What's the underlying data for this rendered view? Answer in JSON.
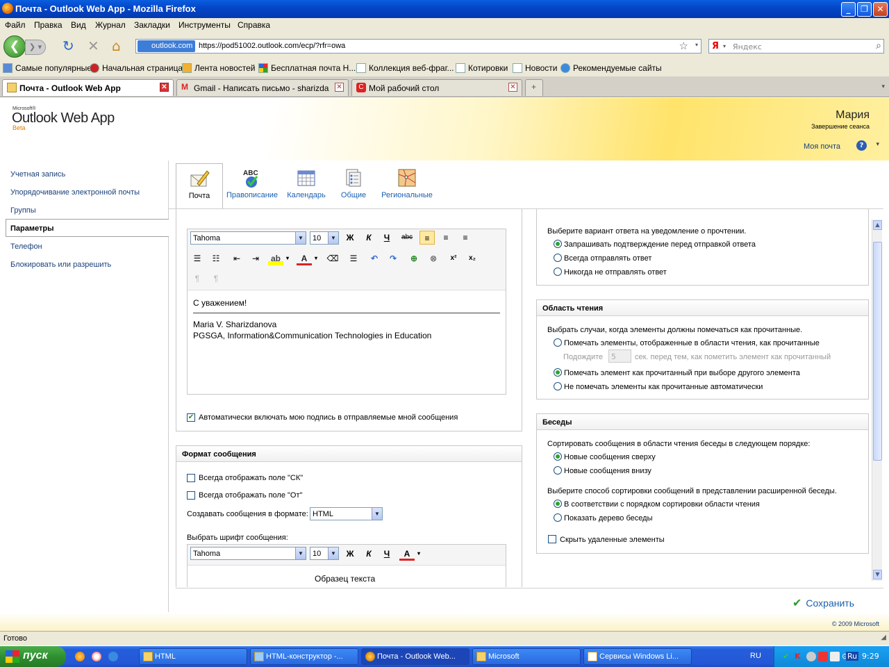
{
  "window": {
    "title": "Почта - Outlook Web App - Mozilla Firefox"
  },
  "menu": [
    "Файл",
    "Правка",
    "Вид",
    "Журнал",
    "Закладки",
    "Инструменты",
    "Справка"
  ],
  "nav": {
    "site_label": "outlook.com",
    "url": "https://pod51002.outlook.com/ecp/?rfr=owa",
    "search_engine": "Я",
    "search_placeholder": "Яндекс"
  },
  "bookmarks": [
    "Самые популярные",
    "Начальная страница",
    "Лента новостей",
    "Бесплатная почта H...",
    "Коллекция веб-фраг...",
    "Котировки",
    "Новости",
    "Рекомендуемые сайты"
  ],
  "tabs": [
    {
      "label": "Почта - Outlook Web App",
      "active": true
    },
    {
      "label": "Gmail - Написать письмо - sharizdanov...",
      "active": false
    },
    {
      "label": "Мой рабочий стол",
      "active": false
    }
  ],
  "owa": {
    "ms": "Microsoft®",
    "logo": "Outlook Web App",
    "beta": "Beta",
    "user": "Мария",
    "signout": "Завершение сеанса",
    "mymail": "Моя почта",
    "help": "?"
  },
  "leftnav": [
    "Учетная запись",
    "Упорядочивание электронной почты",
    "Группы",
    "Параметры",
    "Телефон",
    "Блокировать или разрешить"
  ],
  "icontabs": [
    "Почта",
    "Правописание",
    "Календарь",
    "Общие",
    "Региональные"
  ],
  "editor": {
    "font": "Tahoma",
    "size": "10",
    "tb_bold": "Ж",
    "tb_italic": "К",
    "tb_under": "Ч",
    "tb_strike": "abc",
    "tb_sup": "x²",
    "tb_sub": "x₂",
    "sig_line1": "С уважением!",
    "sig_line2": "Maria V. Sharizdanova",
    "sig_line3": "PGSGA, Information&Communication Technologies in Education",
    "auto_sig": "Автоматически включать мою подпись в отправляемые мной сообщения"
  },
  "format": {
    "title": "Формат сообщения",
    "show_cc": "Всегда отображать поле \"СК\"",
    "show_from": "Всегда отображать поле \"От\"",
    "compose_label": "Создавать сообщения в формате:",
    "compose_value": "HTML",
    "font_label": "Выбрать шрифт сообщения:",
    "font": "Tahoma",
    "size": "10",
    "sample": "Образец текста"
  },
  "receipt": {
    "question": "Выберите вариант ответа на уведомление о прочтении.",
    "opt1": "Запрашивать подтверждение перед отправкой ответа",
    "opt2": "Всегда отправлять ответ",
    "opt3": "Никогда не отправлять ответ"
  },
  "reading": {
    "title": "Область чтения",
    "question": "Выбрать случаи, когда элементы должны помечаться как прочитанные.",
    "opt1": "Помечать элементы, отображенные в области чтения, как прочитанные",
    "wait": "Подождите",
    "wait_value": "5",
    "wait_tail": "сек. перед тем, как пометить элемент как прочитанный",
    "opt2": "Помечать элемент как прочитанный при выборе другого элемента",
    "opt3": "Не помечать элементы как прочитанные автоматически"
  },
  "conv": {
    "title": "Беседы",
    "q1": "Сортировать сообщения в области чтения беседы в следующем порядке:",
    "o1": "Новые сообщения сверху",
    "o2": "Новые сообщения внизу",
    "q2": "Выберите способ сортировки сообщений в представлении расширенной беседы.",
    "o3": "В соответствии с порядком сортировки области чтения",
    "o4": "Показать дерево беседы",
    "hide": "Скрыть удаленные элементы"
  },
  "save": "Сохранить",
  "copyright": "© 2009 Microsoft",
  "status": "Готово",
  "taskbar": {
    "start": "пуск",
    "items": [
      "HTML",
      "HTML-конструктор -...",
      "Почта - Outlook Web...",
      "Microsoft",
      "Сервисы Windows Li..."
    ],
    "lang": "RU",
    "tray_lang": "Ru",
    "clock": "9:29"
  }
}
